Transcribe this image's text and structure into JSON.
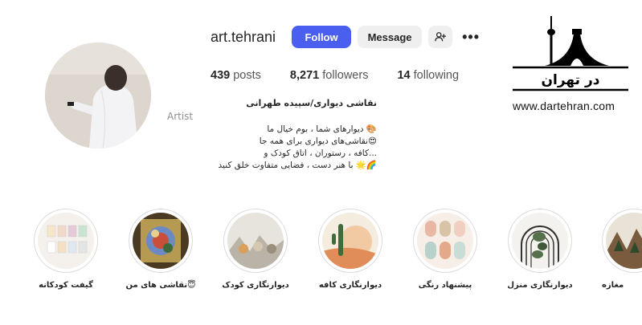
{
  "profile": {
    "username": "art.tehrani",
    "follow_label": "Follow",
    "message_label": "Message",
    "more_label": "•••"
  },
  "stats": {
    "posts_count": "439",
    "posts_label": "posts",
    "followers_count": "8,271",
    "followers_label": "followers",
    "following_count": "14",
    "following_label": "following"
  },
  "bio": {
    "name": "نقاشی دیواری/سپیده طهرانی",
    "category": "Artist",
    "line1": "🎨 دیوارهای شما ، بوم خیال ما",
    "line2": "😍نقاشی‌های دیواری برای همه جا",
    "line3": "...کافه ، رستوران ، اتاق کودک و",
    "line4": "🌈🌟 با هنر دست ، فضایی متفاوت خلق کنید"
  },
  "watermark": {
    "title": "در تهران",
    "url": "www.dartehran.com"
  },
  "highlights": [
    {
      "label": "گیفت کودکانه"
    },
    {
      "label": "😇نقاشی های من"
    },
    {
      "label": "دیوارنگاری کودک"
    },
    {
      "label": "دیوارنگاری کافه"
    },
    {
      "label": "پیشنهاد رنگی"
    },
    {
      "label": "دیوارنگاری منزل"
    },
    {
      "label": "مغازه"
    }
  ],
  "colors": {
    "follow_button": "#4a5ff0",
    "secondary_button": "#efefef",
    "text": "#262626",
    "muted": "#8e8e8e"
  }
}
